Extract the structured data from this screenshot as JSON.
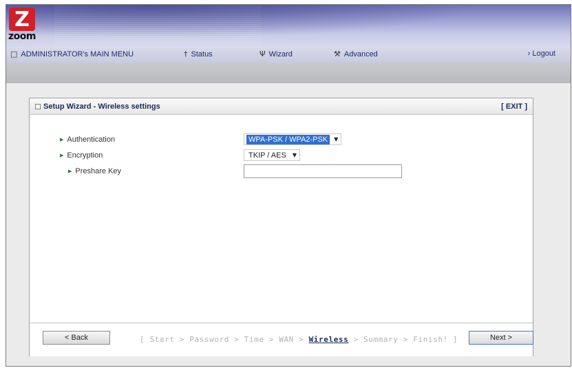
{
  "logo": {
    "mark": "Z",
    "word": "zoom"
  },
  "nav": {
    "main_menu": "ADMINISTRATOR's MAIN MENU",
    "status": "Status",
    "wizard": "Wizard",
    "advanced": "Advanced",
    "logout": "› Logout",
    "icons": {
      "main_menu": "square-icon",
      "status": "person-icon",
      "wizard": "wand-icon",
      "advanced": "tools-icon"
    }
  },
  "panel": {
    "title": "Setup Wizard - Wireless settings",
    "exit": "[ EXIT ]",
    "fields": {
      "authentication": {
        "label": "Authentication",
        "value": "WPA-PSK / WPA2-PSK"
      },
      "encryption": {
        "label": "Encryption",
        "value": "TKIP / AES"
      },
      "preshare": {
        "label": "Preshare Key",
        "value": ""
      }
    }
  },
  "footer": {
    "back": "< Back",
    "next": "Next >",
    "steps_before": "[ Start > Password > Time > WAN > ",
    "steps_current": "Wireless",
    "steps_after": " > Summary > Finish! ]"
  },
  "colors": {
    "accent": "#2f6fd0",
    "brand_red": "#d0202a",
    "nav_text": "#1d2a6d"
  }
}
